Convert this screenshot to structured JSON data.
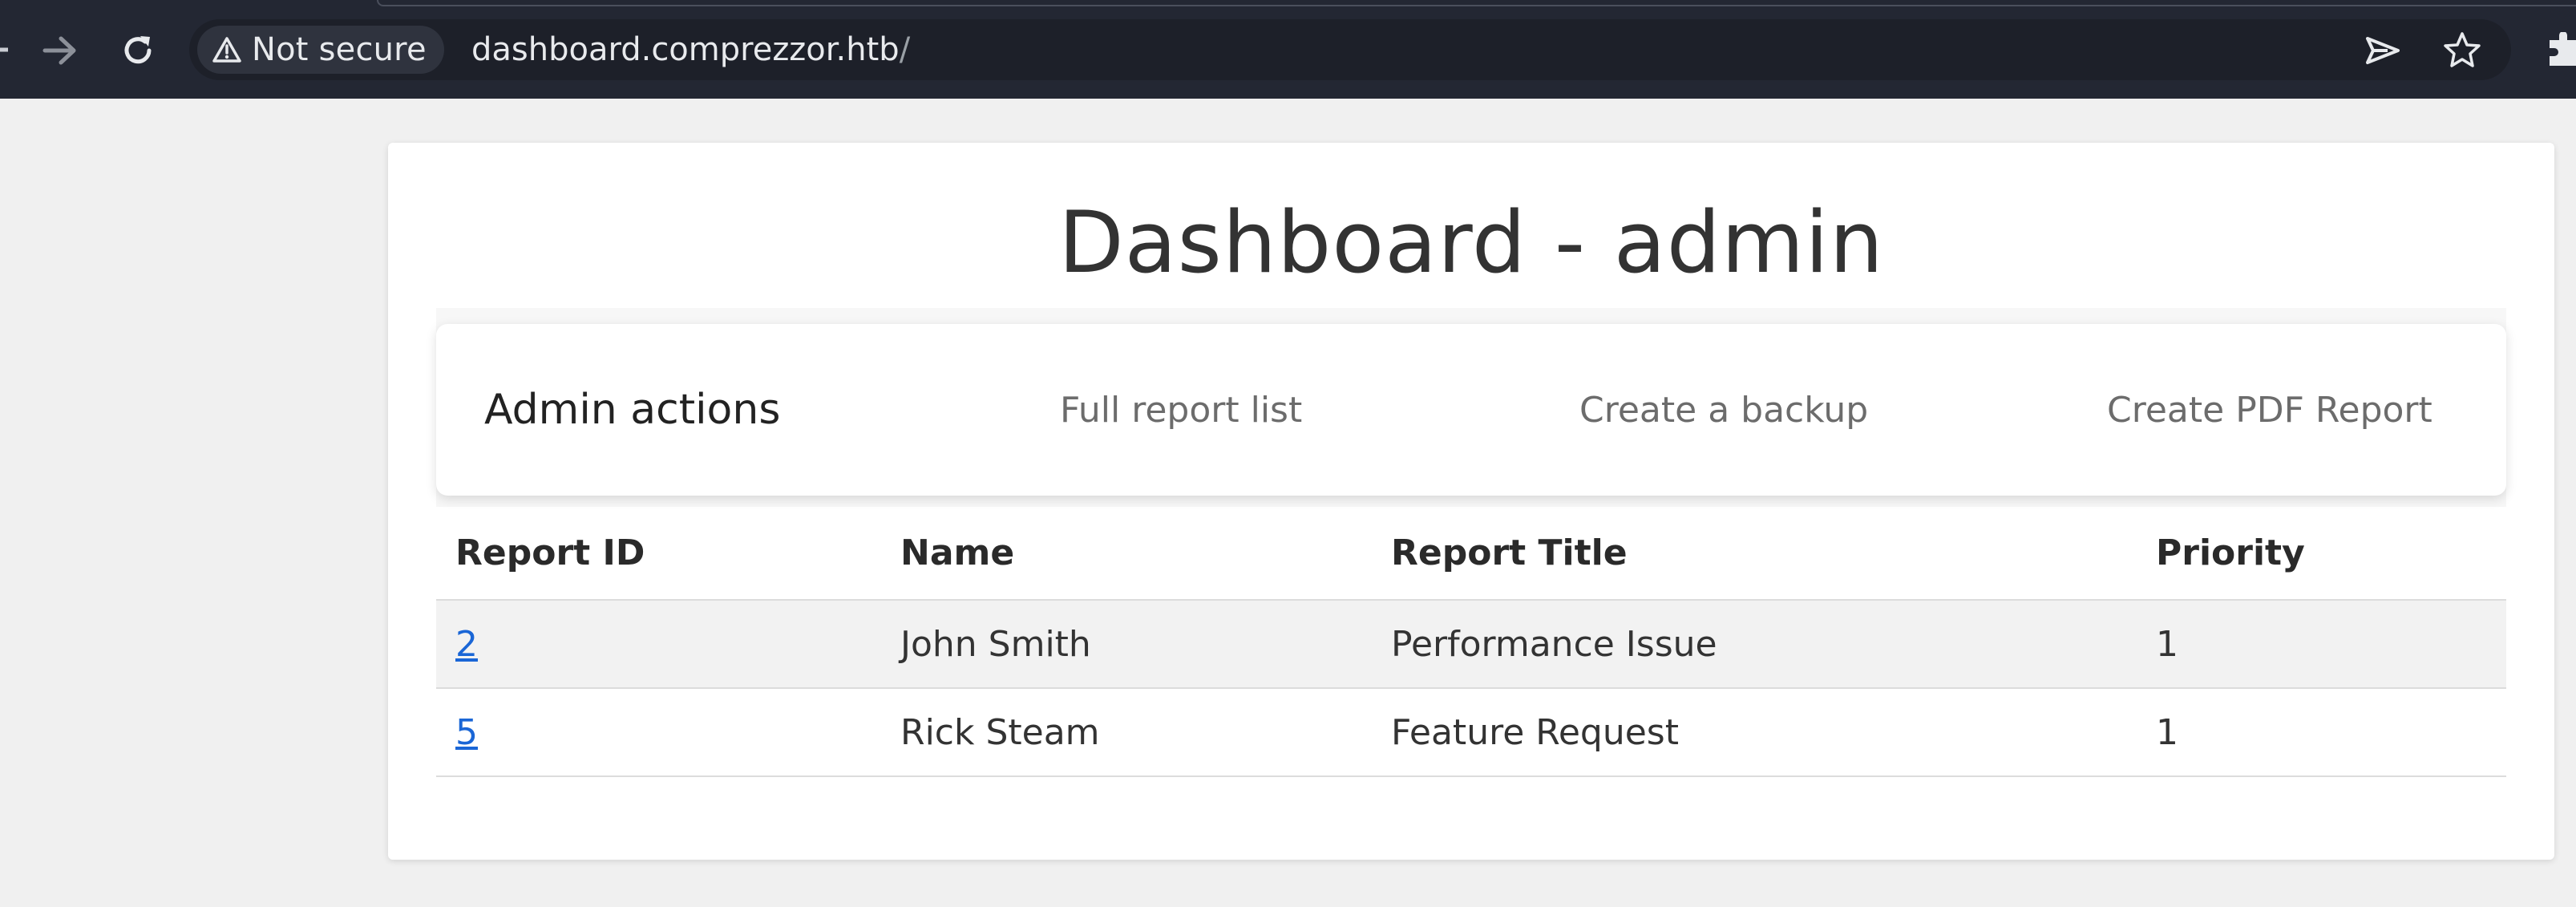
{
  "browser": {
    "security_label": "Not secure",
    "url_host": "dashboard.comprezzor.htb",
    "url_path": "/",
    "icons": [
      "back-icon",
      "forward-icon",
      "reload-icon",
      "warning-icon",
      "share-icon",
      "star-icon",
      "extensions-icon"
    ]
  },
  "page": {
    "title": "Dashboard - admin",
    "nav": {
      "brand": "Admin actions",
      "links": [
        {
          "label": "Full report list"
        },
        {
          "label": "Create a backup"
        },
        {
          "label": "Create PDF Report"
        }
      ]
    },
    "table": {
      "headers": [
        "Report ID",
        "Name",
        "Report Title",
        "Priority"
      ],
      "rows": [
        {
          "id": "2",
          "name": "John Smith",
          "title": "Performance Issue",
          "priority": "1"
        },
        {
          "id": "5",
          "name": "Rick Steam",
          "title": "Feature Request",
          "priority": "1"
        }
      ]
    }
  },
  "colors": {
    "toolbar": "#232733",
    "page_background": "#f0f0f0",
    "link": "#1a66d6"
  }
}
